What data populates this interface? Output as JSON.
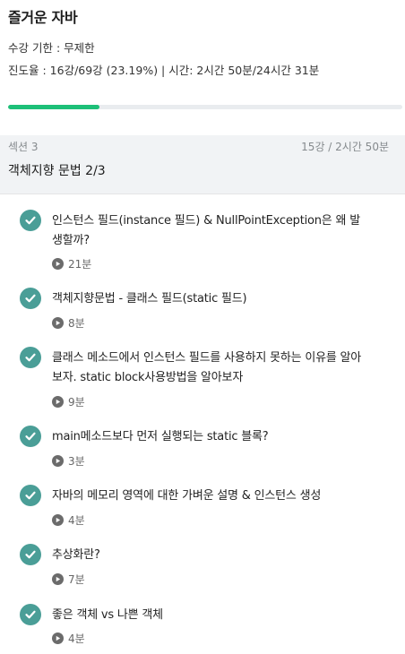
{
  "course": {
    "title": "즐거운 자바",
    "deadline": "수강 기한 : 무제한",
    "progress_text": "진도율 : 16강/69강 (23.19%) | 시간: 2시간 50분/24시간 31분",
    "progress_fraction": 0.2319
  },
  "section": {
    "label": "섹션 3",
    "meta": "15강 / 2시간 50분",
    "title": "객체지향 문법 2/3"
  },
  "lectures": [
    {
      "title": "인스턴스 필드(instance 필드) & NullPointException은 왜 발생할까?",
      "duration": "21분",
      "completed": true
    },
    {
      "title": "객체지향문법 - 클래스 필드(static 필드)",
      "duration": "8분",
      "completed": true
    },
    {
      "title": "클래스 메소드에서 인스턴스 필드를 사용하지 못하는 이유를 알아보자. static block사용방법을 알아보자",
      "duration": "9분",
      "completed": true
    },
    {
      "title": "main메소드보다 먼저 실행되는 static 블록?",
      "duration": "3분",
      "completed": true
    },
    {
      "title": "자바의 메모리 영역에 대한 가벼운 설명 & 인스턴스 생성",
      "duration": "4분",
      "completed": true
    },
    {
      "title": "추상화란?",
      "duration": "7분",
      "completed": true
    },
    {
      "title": "좋은 객체 vs 나쁜 객체",
      "duration": "4분",
      "completed": true
    }
  ],
  "colors": {
    "progress_fill": "#1dc078",
    "check_badge": "#4a9e97"
  },
  "icons": {
    "check": "check-circle-icon",
    "play": "play-circle-icon"
  }
}
